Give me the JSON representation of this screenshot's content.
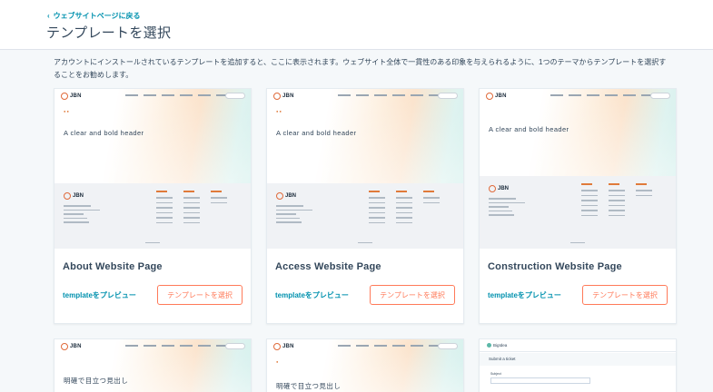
{
  "header": {
    "back_link": "ウェブサイトページに戻る",
    "title": "テンプレートを選択"
  },
  "description": "アカウントにインストールされているテンプレートを追加すると、ここに表示されます。ウェブサイト全体で一貫性のある印象を与えられるように、1つのテーマからテンプレートを選択することをお勧めします。",
  "icons": {
    "back": "chevron-left-icon"
  },
  "colors": {
    "link": "#0091ae",
    "accent": "#ff7a59",
    "text": "#33475b"
  },
  "thumbnail": {
    "brand": "JBN",
    "hero_en": "A clear and bold header",
    "hero_jp": "明確で目立つ見出し"
  },
  "cards": [
    {
      "title": "About Website Page",
      "preview": "templateをプレビュー",
      "select": "テンプレートを選択"
    },
    {
      "title": "Access Website Page",
      "preview": "templateをプレビュー",
      "select": "テンプレートを選択"
    },
    {
      "title": "Construction Website Page",
      "preview": "templateをプレビュー",
      "select": "テンプレートを選択"
    }
  ],
  "help_thumb": {
    "brand": "BigIdea",
    "banner": "Submit a ticket",
    "field_label": "Subject"
  }
}
